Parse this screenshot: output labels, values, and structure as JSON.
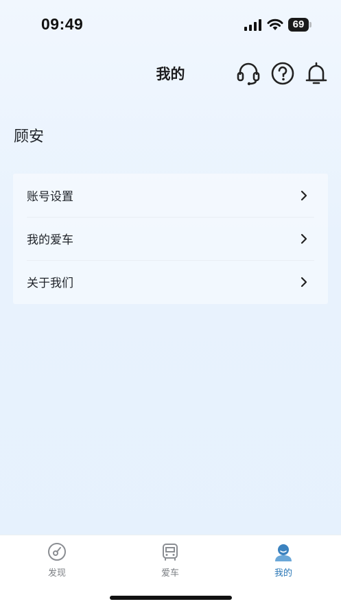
{
  "status_bar": {
    "time": "09:49",
    "battery": "69",
    "icons": [
      "signal-icon",
      "wifi-icon",
      "battery-icon"
    ]
  },
  "header": {
    "title": "我的",
    "icons": [
      "headset-icon",
      "help-icon",
      "bell-icon"
    ]
  },
  "user": {
    "name": "顾安"
  },
  "menu": {
    "items": [
      {
        "label": "账号设置",
        "icon": "chevron-right-icon"
      },
      {
        "label": "我的爱车",
        "icon": "chevron-right-icon"
      },
      {
        "label": "关于我们",
        "icon": "chevron-right-icon"
      }
    ]
  },
  "tabbar": {
    "tabs": [
      {
        "label": "发现",
        "icon": "discover-icon",
        "active": false
      },
      {
        "label": "爱车",
        "icon": "car-icon",
        "active": false
      },
      {
        "label": "我的",
        "icon": "profile-icon",
        "active": true
      }
    ]
  },
  "colors": {
    "accent": "#2a77b6",
    "inactive": "#7d8085",
    "background": "#e8f2fd"
  }
}
